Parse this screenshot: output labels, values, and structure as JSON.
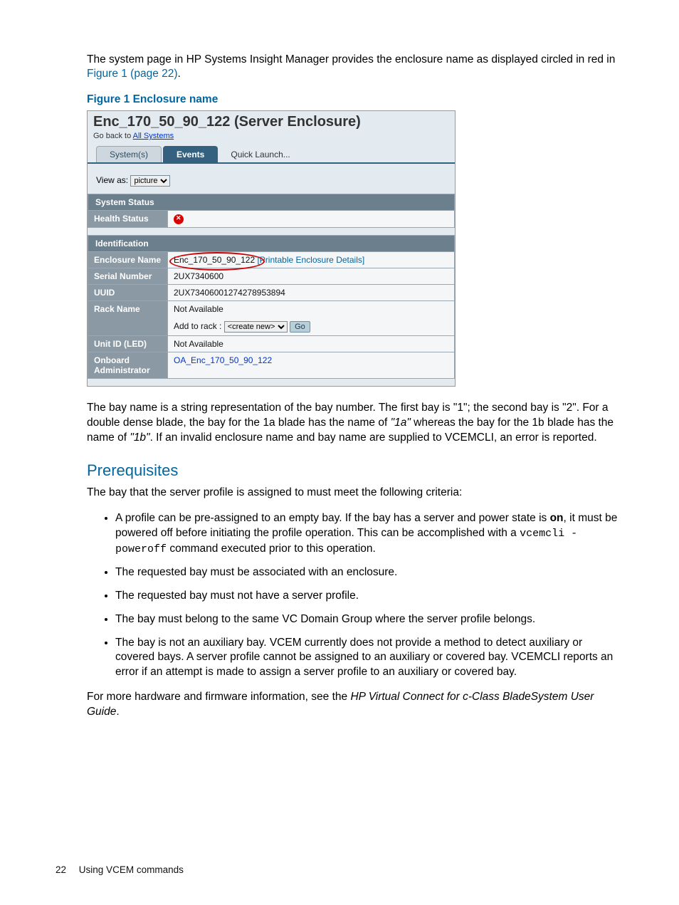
{
  "intro": {
    "text1": "The system page in HP Systems Insight Manager provides the enclosure name as displayed circled in red in ",
    "link": "Figure 1 (page 22)",
    "text2": "."
  },
  "figureCaption": "Figure 1 Enclosure name",
  "screenshot": {
    "title": "Enc_170_50_90_122 (Server Enclosure)",
    "goBackPrefix": "Go back to ",
    "goBackLink": "All Systems",
    "tabs": {
      "system": "System(s)",
      "events": "Events",
      "quicklaunch": "Quick Launch..."
    },
    "viewAsLabel": "View as:",
    "viewAsValue": "picture",
    "systemStatus": "System Status",
    "healthStatusLabel": "Health Status",
    "identification": "Identification",
    "rowEnclosureLabel": "Enclosure Name",
    "rowEnclosureValue": "Enc_170_50_90_122",
    "rowEnclosureHint": "[Printable Enclosure Details]",
    "rowSerialLabel": "Serial Number",
    "rowSerialValue": "2UX7340600",
    "rowUUIDLabel": "UUID",
    "rowUUIDValue": "2UX73406001274278953894",
    "rowRackLabel": "Rack Name",
    "rowRackValue": "Not Available",
    "addToRackLabel": "Add to rack :",
    "addToRackOption": "<create new>",
    "goBtn": "Go",
    "rowUnitIDLabel": "Unit ID (LED)",
    "rowUnitIDValue": "Not Available",
    "rowOALabel": "Onboard Administrator",
    "rowOAValue": "OA_Enc_170_50_90_122"
  },
  "bayPara": {
    "t1": "The bay name is a string representation of the bay number. The first bay is \"1\"; the second bay is \"2\". For a double dense blade, the bay for the 1a blade has the name of ",
    "i1": "\"1a\"",
    "t2": " whereas the bay for the 1b blade has the name of ",
    "i2": "\"1b\"",
    "t3": ". If an invalid enclosure name and bay name are supplied to VCEMCLI, an error is reported."
  },
  "prereqHeading": "Prerequisites",
  "prereqIntro": "The bay that the server profile is assigned to must meet the following criteria:",
  "reqs": {
    "r1a": "A profile can be pre-assigned to an empty bay. If the bay has a server and power state is ",
    "r1b": "on",
    "r1c": ", it must be powered off before initiating the profile operation. This can be accomplished with a ",
    "r1d": "vcemcli -poweroff",
    "r1e": " command executed prior to this operation.",
    "r2": "The requested bay must be associated with an enclosure.",
    "r3": "The requested bay must not have a server profile.",
    "r4": "The bay must belong to the same VC Domain Group where the server profile belongs.",
    "r5": "The bay is not an auxiliary bay. VCEM currently does not provide a method to detect auxiliary or covered bays. A server profile cannot be assigned to an auxiliary or covered bay. VCEMCLI reports an error if an attempt is made to assign a server profile to an auxiliary or covered bay."
  },
  "morePara": {
    "t1": "For more hardware and firmware information, see the ",
    "i1": "HP Virtual Connect for c-Class BladeSystem User Guide",
    "t2": "."
  },
  "footer": {
    "pageNum": "22",
    "section": "Using VCEM commands"
  }
}
